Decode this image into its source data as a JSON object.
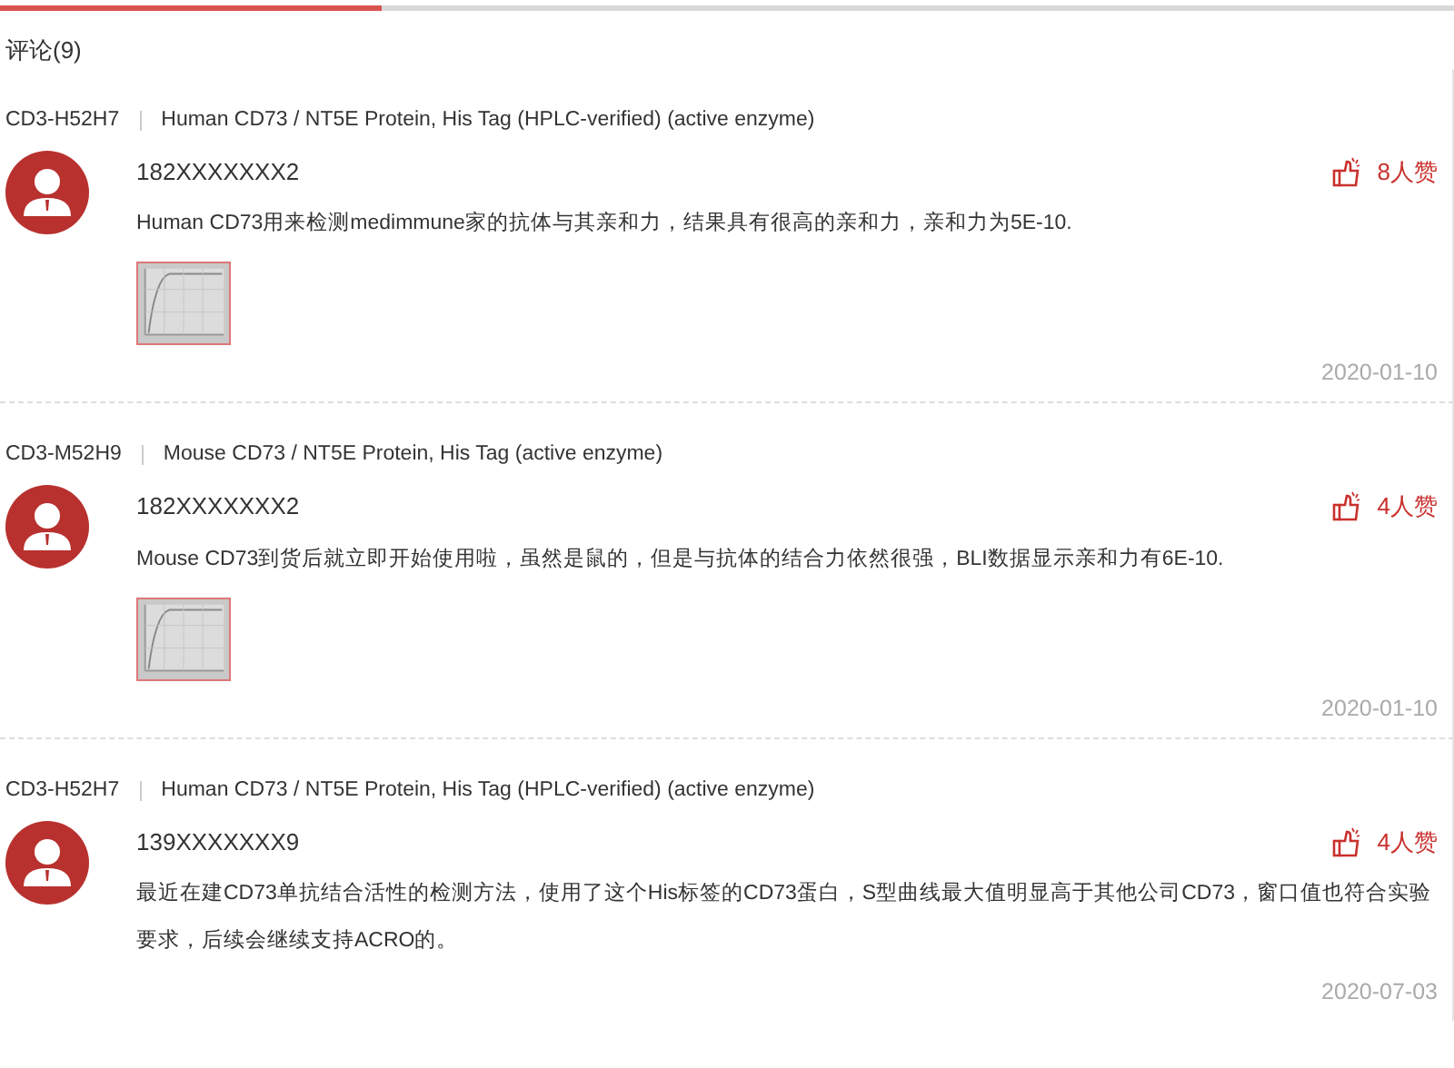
{
  "tabs": [
    {
      "selected": true
    },
    {
      "selected": false
    }
  ],
  "heading": "评论(9)",
  "comments": [
    {
      "sku": "CD3-H52H7",
      "product": "Human CD73 / NT5E Protein, His Tag (HPLC-verified) (active enzyme)",
      "user": "182XXXXXXX2",
      "likes": "8人赞",
      "text": "Human CD73用来检测medimmune家的抗体与其亲和力，结果具有很高的亲和力，亲和力为5E-10.",
      "date": "2020-01-10"
    },
    {
      "sku": "CD3-M52H9",
      "product": "Mouse CD73 / NT5E Protein, His Tag (active enzyme)",
      "user": "182XXXXXXX2",
      "likes": "4人赞",
      "text": "Mouse CD73到货后就立即开始使用啦，虽然是鼠的，但是与抗体的结合力依然很强，BLI数据显示亲和力有6E-10.",
      "date": "2020-01-10"
    },
    {
      "sku": "CD3-H52H7",
      "product": "Human CD73 / NT5E Protein, His Tag (HPLC-verified) (active enzyme)",
      "user": "139XXXXXXX9",
      "likes": "4人赞",
      "text": "最近在建CD73单抗结合活性的检测方法，使用了这个His标签的CD73蛋白，S型曲线最大值明显高于其他公司CD73，窗口值也符合实验要求，后续会继续支持ACRO的。",
      "date": "2020-07-03"
    }
  ]
}
